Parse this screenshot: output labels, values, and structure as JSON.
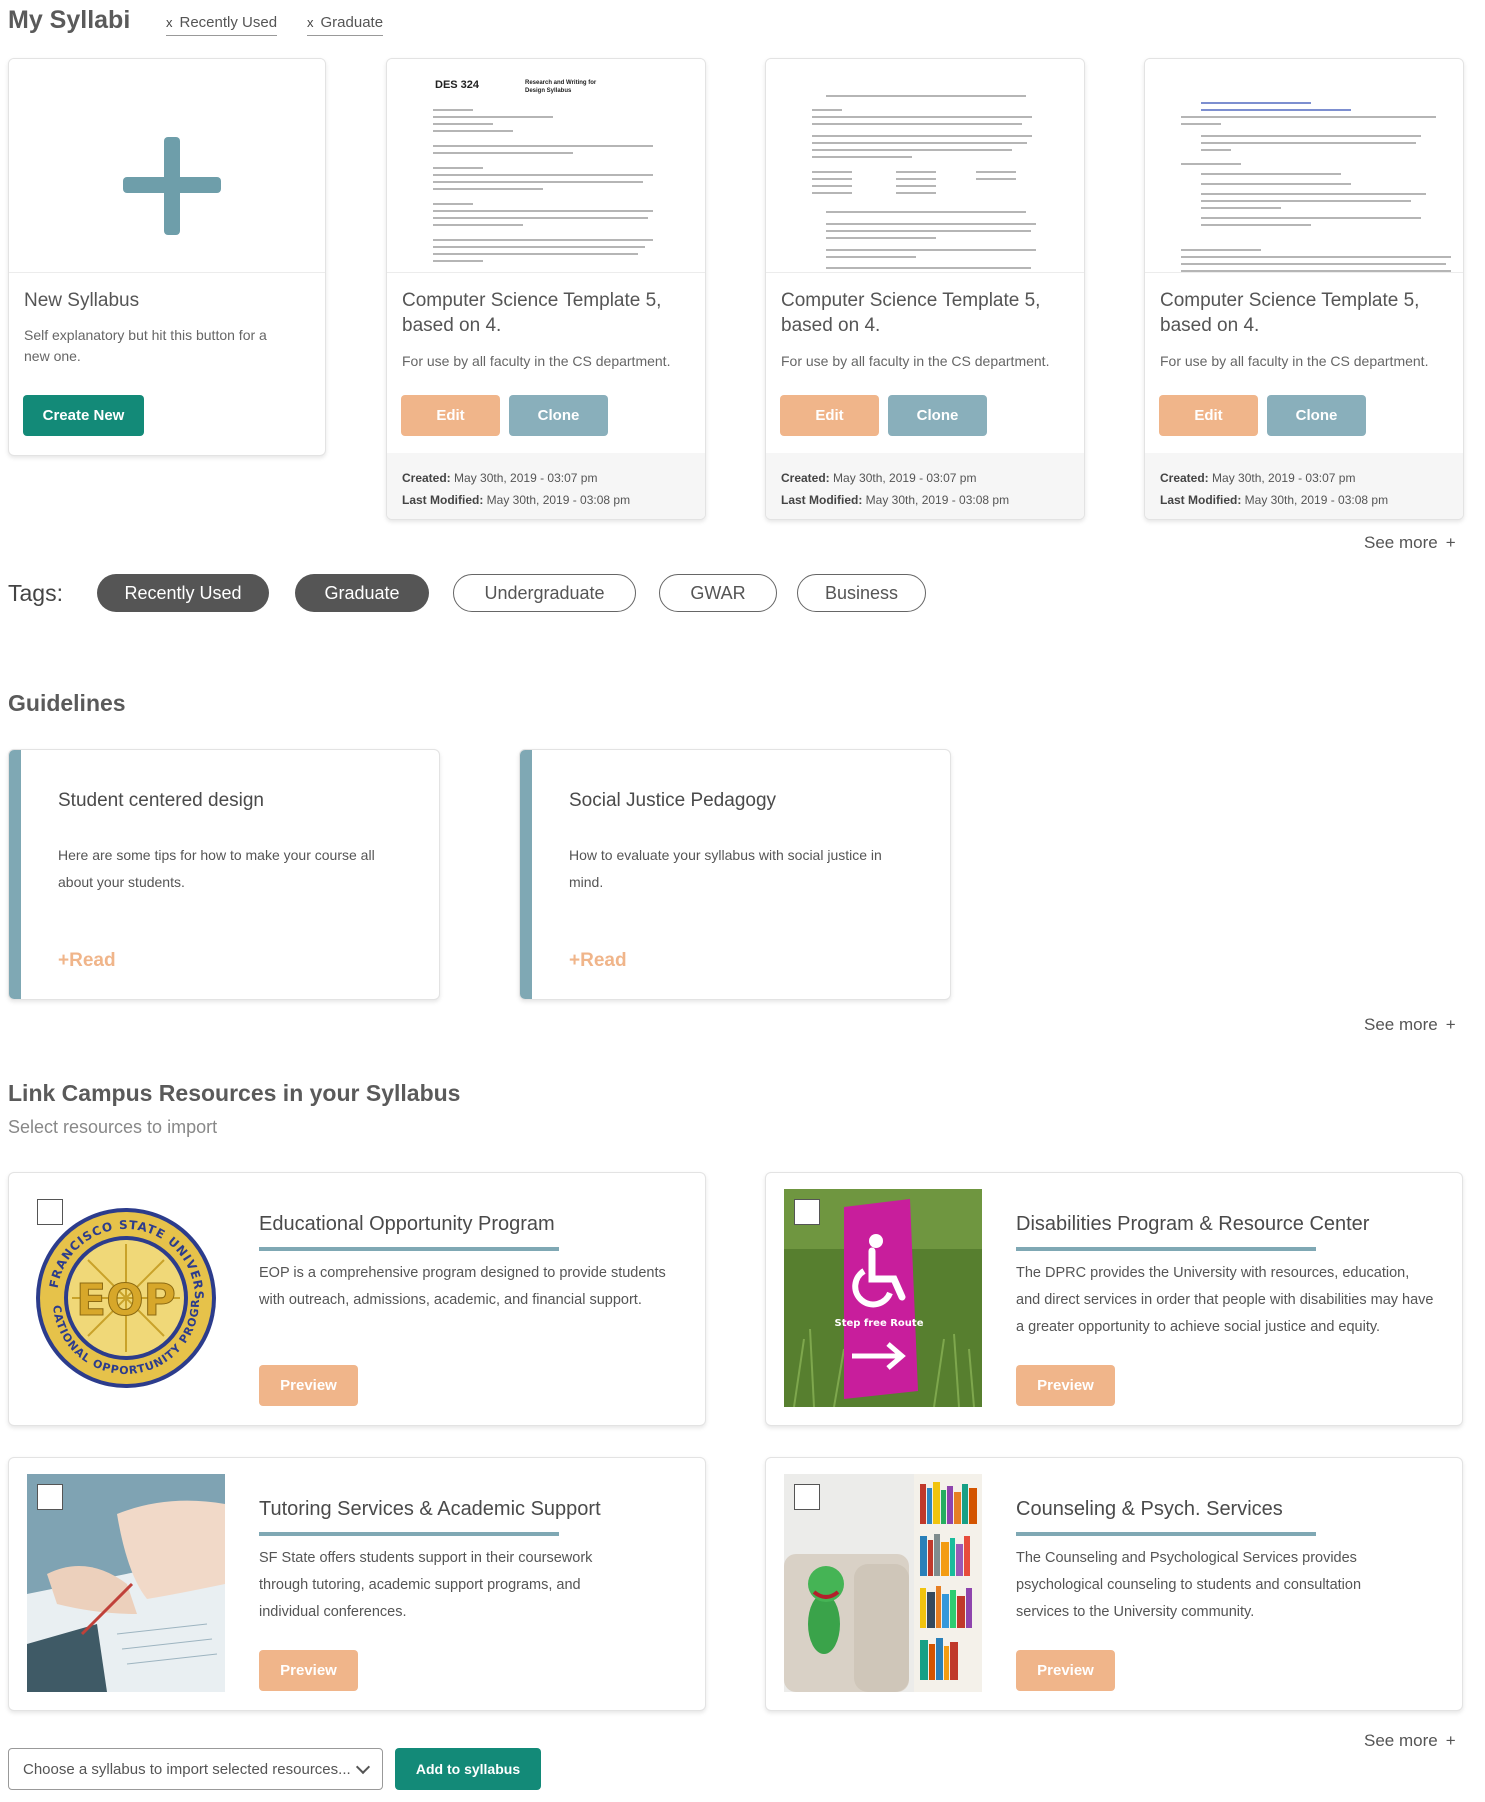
{
  "header": {
    "title": "My Syllabi",
    "filters": [
      "Recently Used",
      "Graduate"
    ]
  },
  "new_card": {
    "title": "New Syllabus",
    "description": "Self explanatory but hit this button for a new one.",
    "button": "Create New"
  },
  "templates": [
    {
      "title": "Computer Science Template 5, based on 4.",
      "description": "For use by all faculty in the CS department.",
      "edit": "Edit",
      "clone": "Clone",
      "created_label": "Created:",
      "created": "May 30th, 2019 - 03:07 pm",
      "modified_label": "Last Modified:",
      "modified": "May 30th, 2019 - 03:08 pm"
    },
    {
      "title": "Computer Science Template 5, based on 4.",
      "description": "For use by all faculty in the CS department.",
      "edit": "Edit",
      "clone": "Clone",
      "created_label": "Created:",
      "created": "May 30th, 2019 - 03:07 pm",
      "modified_label": "Last Modified:",
      "modified": "May 30th, 2019 - 03:08 pm"
    },
    {
      "title": "Computer Science Template 5, based on 4.",
      "description": "For use by all faculty in the CS department.",
      "edit": "Edit",
      "clone": "Clone",
      "created_label": "Created:",
      "created": "May 30th, 2019 - 03:07 pm",
      "modified_label": "Last Modified:",
      "modified": "May 30th, 2019 - 03:08 pm"
    }
  ],
  "thumb_doc": {
    "course": "DES 324",
    "heading": "Research and Writing for Design Syllabus"
  },
  "see_more": "See more",
  "tags": {
    "label": "Tags:",
    "items": [
      {
        "label": "Recently Used",
        "active": true
      },
      {
        "label": "Graduate",
        "active": true
      },
      {
        "label": "Undergraduate",
        "active": false
      },
      {
        "label": "GWAR",
        "active": false
      },
      {
        "label": "Business",
        "active": false
      }
    ]
  },
  "guidelines": {
    "title": "Guidelines",
    "items": [
      {
        "title": "Student centered design",
        "description": "Here are some tips for how to make your course all about your students.",
        "read": "+Read"
      },
      {
        "title": "Social Justice Pedagogy",
        "description": "How to evaluate your syllabus with social justice in mind.",
        "read": "+Read"
      }
    ]
  },
  "resources": {
    "title": "Link Campus Resources in your Syllabus",
    "subtitle": "Select resources to import",
    "items": [
      {
        "title": "Educational Opportunity Program",
        "description": "EOP is a comprehensive program designed to provide students with outreach, admissions, academic, and financial support.",
        "preview": "Preview",
        "image": "eop-seal"
      },
      {
        "title": "Disabilities Program & Resource Center",
        "description": "The DPRC provides the University with resources, education, and direct services in order that people with disabilities may have a greater opportunity to achieve social justice and equity.",
        "preview": "Preview",
        "image": "step-free-route-sign"
      },
      {
        "title": "Tutoring Services & Academic Support",
        "description": "SF State offers students support in their  coursework through tutoring, academic support programs, and individual conferences.",
        "preview": "Preview",
        "image": "writing-hands-photo"
      },
      {
        "title": "Counseling & Psych. Services",
        "description": "The Counseling and Psychological Services provides psychological counseling to students and consultation services to the University community.",
        "preview": "Preview",
        "image": "bookshelf-chair-photo"
      }
    ],
    "seal": {
      "top": "SAN FRANCISCO STATE UNIVERSITY",
      "bottom": "EDUCATIONAL OPPORTUNITY PROGRAM",
      "center": "EOP"
    },
    "sign_text": "Step free Route"
  },
  "import": {
    "placeholder": "Choose a syllabus to import selected resources...",
    "button": "Add to syllabus"
  }
}
